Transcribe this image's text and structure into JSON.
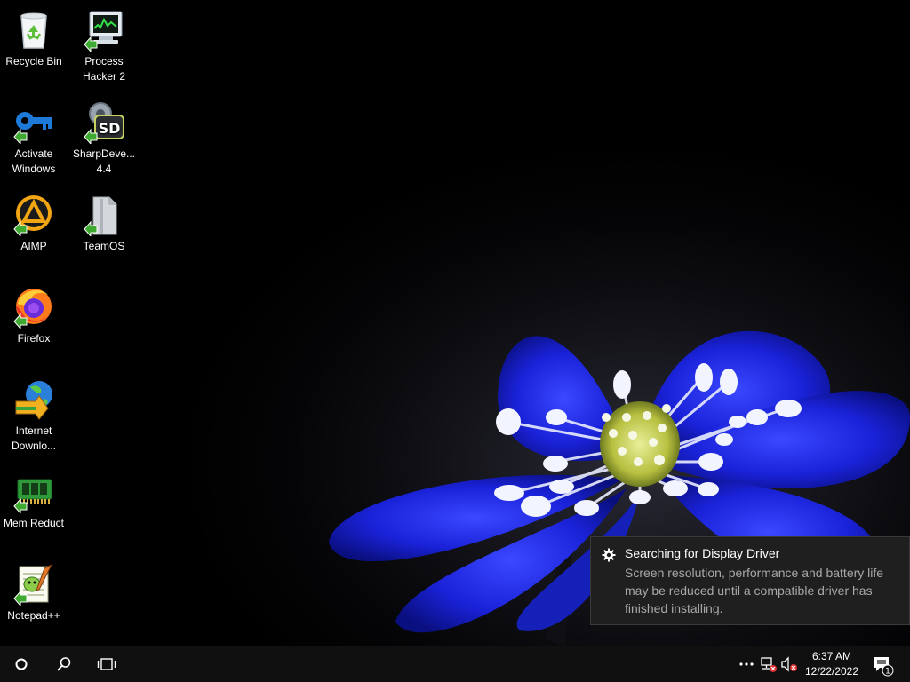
{
  "desktop": {
    "icons": [
      {
        "label": "Recycle Bin",
        "icon": "recycle-bin-icon"
      },
      {
        "label": "Process Hacker 2",
        "icon": "process-hacker-icon"
      },
      {
        "label": "Activate Windows",
        "icon": "key-icon"
      },
      {
        "label": "SharpDeve... 4.4",
        "icon": "sharpdevelop-icon"
      },
      {
        "label": "AIMP",
        "icon": "aimp-icon"
      },
      {
        "label": "TeamOS",
        "icon": "teamos-icon"
      },
      {
        "label": "Firefox",
        "icon": "firefox-icon"
      },
      {
        "label": "Internet Downlo...",
        "icon": "internet-download-manager-icon"
      },
      {
        "label": "Mem Reduct",
        "icon": "mem-reduct-icon"
      },
      {
        "label": "Notepad++",
        "icon": "notepad-plus-plus-icon"
      }
    ]
  },
  "toast": {
    "title": "Searching for Display Driver",
    "body": "Screen resolution, performance and battery life may be reduced until a compatible driver has finished installing.",
    "icon": "gear-icon"
  },
  "taskbar": {
    "start_icon": "start-circle-icon",
    "search_icon": "search-icon",
    "task_view_icon": "task-view-icon",
    "tray": {
      "overflow_icon": "more-dots-icon",
      "network_icon": "network-disconnected-icon",
      "volume_icon": "volume-muted-icon"
    },
    "clock": {
      "time": "6:37 AM",
      "date": "12/22/2022"
    },
    "notification_count": "1"
  },
  "colors": {
    "taskbar": "#101010",
    "toast_bg": "#1f1f1f",
    "flower": "#1a28e0"
  }
}
